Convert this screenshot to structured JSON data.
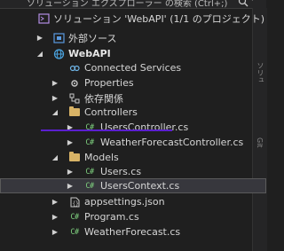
{
  "search": {
    "title": "ソリューション エクスプローラー の検索 (Ctrl+;)"
  },
  "tree": {
    "solution": "ソリューション 'WebAPI' (1/1 のプロジェクト)",
    "external_sources": "外部ソース",
    "project": "WebAPI",
    "connected_services": "Connected Services",
    "properties": "Properties",
    "dependencies": "依存関係",
    "controllers_folder": "Controllers",
    "users_controller": "UsersController.cs",
    "weather_controller": "WeatherForecastController.cs",
    "models_folder": "Models",
    "users_model": "Users.cs",
    "users_context": "UsersContext.cs",
    "appsettings": "appsettings.json",
    "program": "Program.cs",
    "weather_forecast": "WeatherForecast.cs"
  },
  "side_labels": {
    "a": "ソリュ",
    "b": "Git"
  },
  "icons": {
    "cs": "C#",
    "dependencies": "dependencies-icon",
    "connected": "connected-services-icon"
  },
  "colors": {
    "background": "#1f1f1f",
    "selection": "#37373d",
    "annotation": "#5b1fcf",
    "cs_badge": "#7fd17f",
    "folder": "#d8b366"
  }
}
